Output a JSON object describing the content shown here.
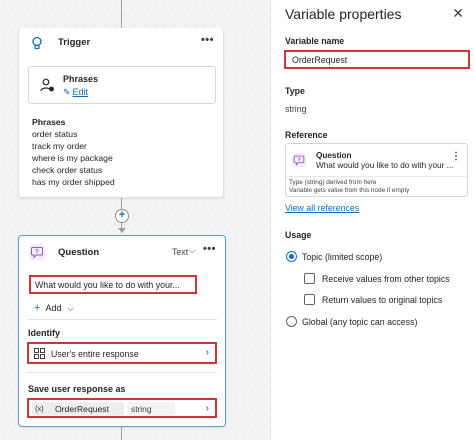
{
  "trigger": {
    "title": "Trigger",
    "more": "•••",
    "phrases_box": {
      "title": "Phrases",
      "edit_label": "Edit"
    },
    "phrases_heading": "Phrases",
    "phrases": [
      "order status",
      "track my order",
      "where is my package",
      "check order status",
      "has my order shipped"
    ]
  },
  "canvas": {
    "add_node_label": "+"
  },
  "question": {
    "title": "Question",
    "type_label": "Text",
    "more": "•••",
    "prompt": "What would you like to do with your...",
    "add_label": "Add",
    "identify_heading": "Identify",
    "identify_value": "User's entire response",
    "save_heading": "Save user response as",
    "variable_icon": "{x}",
    "variable_name": "OrderRequest",
    "variable_type": "string"
  },
  "panel": {
    "title": "Variable properties",
    "close": "✕",
    "variable_name_label": "Variable name",
    "variable_name_value": "OrderRequest",
    "type_label": "Type",
    "type_value": "string",
    "reference_label": "Reference",
    "reference": {
      "title": "Question",
      "subtitle": "What would you like to do with your ...",
      "more": "⋮",
      "note_line1": "Type (string) derived from here",
      "note_line2": "Variable gets value from this node if empty"
    },
    "view_all_label": "View all references",
    "usage_label": "Usage",
    "options": {
      "topic": "Topic (limited scope)",
      "receive": "Receive values from other topics",
      "return": "Return values to original topics",
      "global": "Global (any topic can access)"
    }
  },
  "colors": {
    "accent": "#0f6cbd",
    "highlight": "#d13438",
    "question_icon": "#8764b8",
    "trigger_icon": "#0f6cbd"
  }
}
